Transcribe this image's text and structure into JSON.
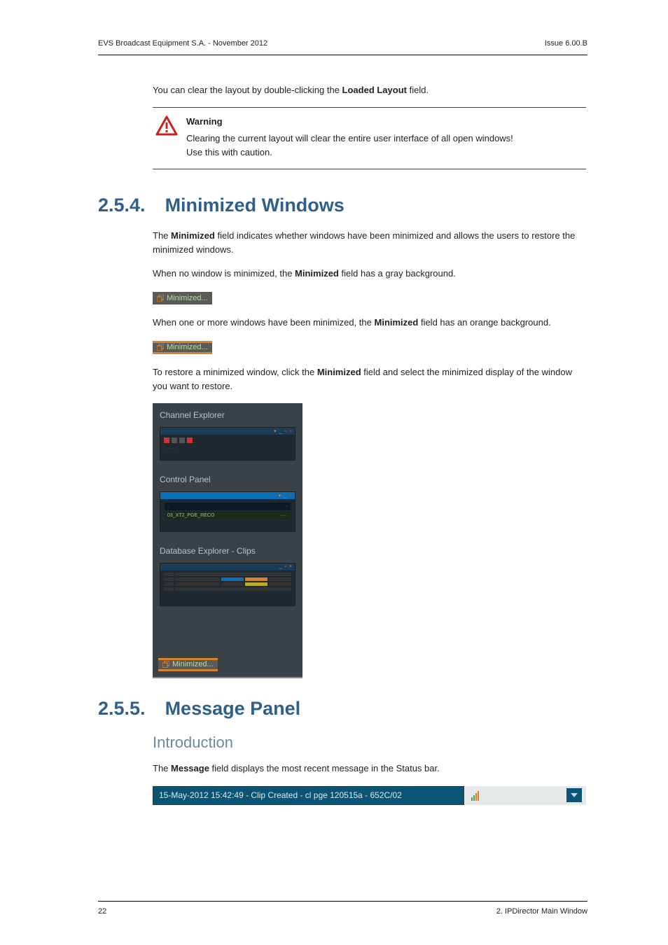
{
  "header": {
    "left": "EVS Broadcast Equipment S.A. - November 2012",
    "right": "Issue 6.00.B"
  },
  "intro_para": {
    "pre": "You can clear the layout by double-clicking the ",
    "bold": "Loaded Layout",
    "post": " field."
  },
  "warning": {
    "title": "Warning",
    "line1": "Clearing the current layout will clear the entire user interface of all open windows!",
    "line2": "Use this with caution."
  },
  "sec254": {
    "num": "2.5.4.",
    "title": "Minimized Windows",
    "p1": {
      "pre": "The ",
      "b": "Minimized",
      "post": " field indicates whether windows have been minimized and allows the users to restore the minimized windows."
    },
    "p2": {
      "pre": "When no window is minimized, the ",
      "b": "Minimized",
      "post": " field has a gray background."
    },
    "badge1": "Minimized...",
    "p3": {
      "pre": "When one or more windows have been minimized, the ",
      "b": "Minimized",
      "post": " field has an orange background."
    },
    "badge2": "Minimized...",
    "p4": {
      "pre": "To restore a minimized window, click the ",
      "b": "Minimized",
      "post": " field and select the minimized display of the window you want to restore."
    },
    "popup": {
      "sec1": "Channel Explorer",
      "sec2": "Control Panel",
      "sec2_sub1": "03_XT2_PGE_RECO",
      "sec3": "Database Explorer - Clips",
      "footer_badge": "Minimized..."
    }
  },
  "sec255": {
    "num": "2.5.5.",
    "title": "Message Panel",
    "sub": "Introduction",
    "p1": {
      "pre": "The ",
      "b": "Message",
      "post": " field displays the most recent message in the Status bar."
    },
    "msg": "15-May-2012 15:42:49 - Clip Created - cl pge 120515a - 652C/02"
  },
  "footer": {
    "left": "22",
    "right": "2. IPDirector Main Window"
  }
}
